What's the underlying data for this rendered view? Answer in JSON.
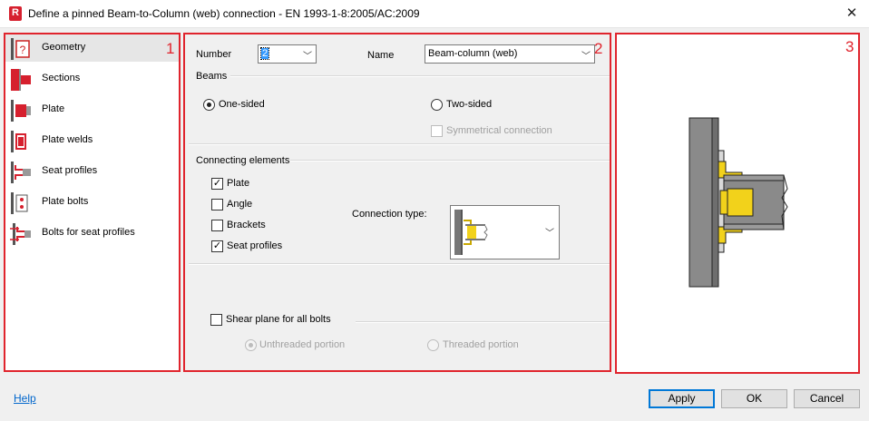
{
  "window": {
    "app_icon_letter": "R",
    "title": "Define a pinned Beam-to-Column (web) connection - EN 1993-1-8:2005/AC:2009",
    "close_glyph": "✕"
  },
  "panels": {
    "left_number": "1",
    "middle_number": "2",
    "right_number": "3"
  },
  "sidebar": {
    "items": [
      {
        "label": "Geometry",
        "icon": "geometry-icon",
        "selected": true
      },
      {
        "label": "Sections",
        "icon": "sections-icon",
        "selected": false
      },
      {
        "label": "Plate",
        "icon": "plate-icon",
        "selected": false
      },
      {
        "label": "Plate welds",
        "icon": "plate-welds-icon",
        "selected": false
      },
      {
        "label": "Seat profiles",
        "icon": "seat-profiles-icon",
        "selected": false
      },
      {
        "label": "Plate bolts",
        "icon": "plate-bolts-icon",
        "selected": false
      },
      {
        "label": "Bolts for seat profiles",
        "icon": "bolts-seat-profiles-icon",
        "selected": false
      }
    ]
  },
  "form": {
    "number_label": "Number",
    "number_value": "2",
    "name_label": "Name",
    "name_value": "Beam-column (web)",
    "beams_group": "Beams",
    "one_sided": "One-sided",
    "two_sided": "Two-sided",
    "symmetrical": "Symmetrical connection",
    "connecting_group": "Connecting elements",
    "plate": "Plate",
    "angle": "Angle",
    "brackets": "Brackets",
    "seat_profiles": "Seat profiles",
    "connection_type_label": "Connection type:",
    "shear_plane": "Shear plane for all bolts",
    "unthreaded": "Unthreaded portion",
    "threaded": "Threaded portion"
  },
  "checks": {
    "plate": true,
    "angle": false,
    "brackets": false,
    "seat_profiles": true,
    "shear_plane": false,
    "symmetrical": false
  },
  "footer": {
    "help": "Help",
    "apply": "Apply",
    "ok": "OK",
    "cancel": "Cancel"
  },
  "colors": {
    "accent": "#e0242d",
    "steel": "#8a8a8a",
    "weld": "#f2d21b",
    "link": "#0066cc"
  }
}
